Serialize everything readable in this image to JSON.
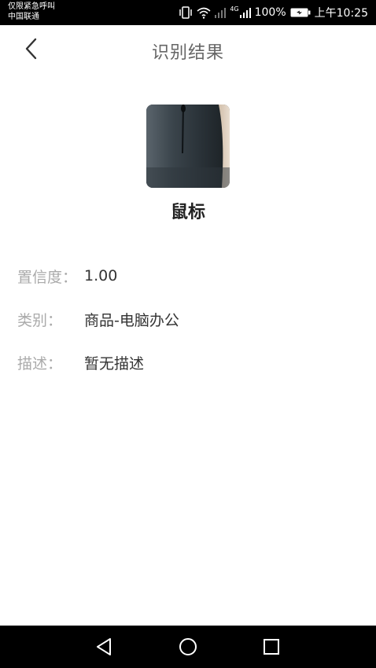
{
  "status_bar": {
    "carrier_line1": "仅限紧急呼叫",
    "carrier_line2": "中国联通",
    "network": "4G",
    "battery": "100%",
    "time": "上午10:25"
  },
  "header": {
    "title": "识别结果"
  },
  "result": {
    "name": "鼠标",
    "rows": [
      {
        "label": "置信度：",
        "value": "1.00"
      },
      {
        "label": "类别：",
        "value": "商品-电脑办公"
      },
      {
        "label": "描述：",
        "value": "暂无描述"
      }
    ]
  }
}
